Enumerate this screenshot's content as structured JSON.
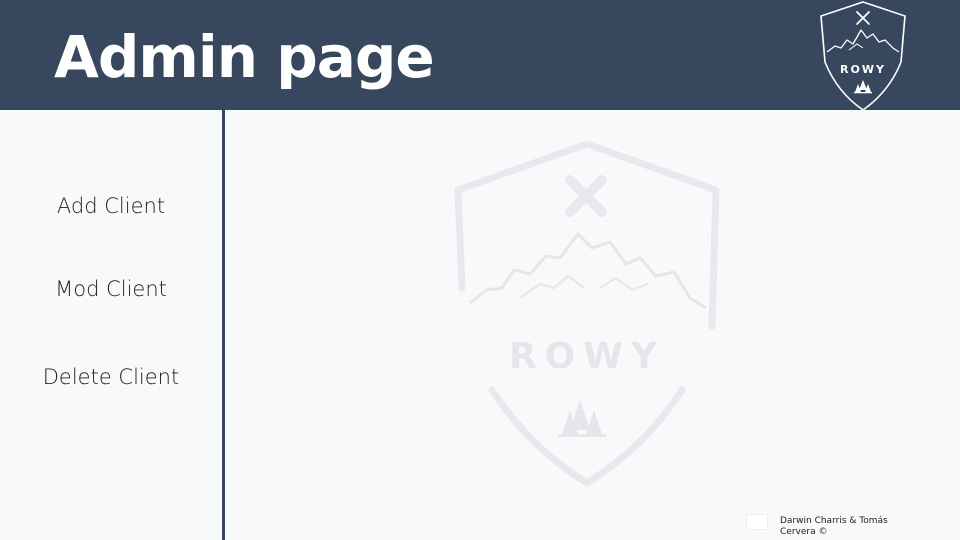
{
  "header": {
    "title": "Admin page",
    "logo_text": "ROWY",
    "background_color": "#36475e"
  },
  "sidebar": {
    "items": [
      {
        "label": "Add Client"
      },
      {
        "label": "Mod Client"
      },
      {
        "label": "Delete Client"
      }
    ]
  },
  "main": {
    "watermark_text": "ROWY"
  },
  "footer": {
    "credit": "Darwin Charris & Tomás Cervera ©"
  },
  "colors": {
    "header_bg": "#36475e",
    "page_bg": "#f8f9fb",
    "divider": "#36475e",
    "watermark": "#e3e5e9"
  },
  "icons": {
    "header_logo": "rowy-logo-icon",
    "watermark": "rowy-watermark-icon"
  }
}
